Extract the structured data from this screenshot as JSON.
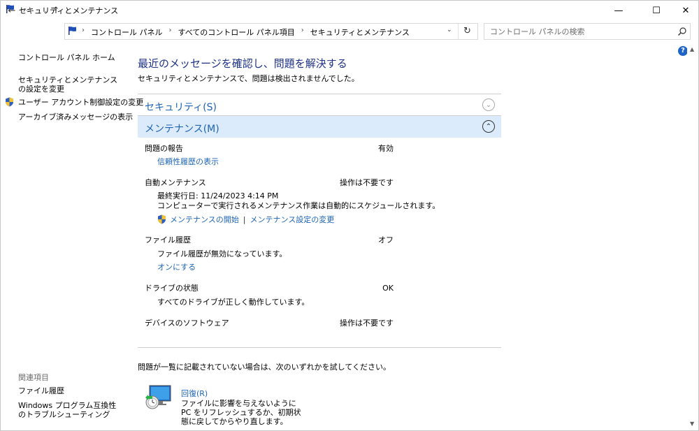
{
  "window": {
    "title": "セキュリティとメンテナンス",
    "minimize": "—",
    "maximize": "☐",
    "close": "✕"
  },
  "nav": {
    "back": "←",
    "forward": "→",
    "recent": "⌄",
    "up": "↑"
  },
  "address": {
    "crumbs": [
      "コントロール パネル",
      "すべてのコントロール パネル項目",
      "セキュリティとメンテナンス"
    ],
    "separator": "›",
    "first_separator": "›",
    "dropdown": "⌄",
    "refresh": "↻"
  },
  "search": {
    "placeholder": "コントロール パネルの検索"
  },
  "sidebar": {
    "home": "コントロール パネル ホーム",
    "settings": "セキュリティとメンテナンスの設定を変更",
    "uac": "ユーザー アカウント制御設定の変更",
    "archive": "アーカイブ済みメッセージの表示",
    "related_title": "関連項目",
    "file_history": "ファイル履歴",
    "compat": "Windows プログラム互換性のトラブルシューティング"
  },
  "main": {
    "heading": "最近のメッセージを確認し、問題を解決する",
    "subheading": "セキュリティとメンテナンスで、問題は検出されませんでした。",
    "security_label": "セキュリティ(S)",
    "maintenance_label": "メンテナンス(M)",
    "expand_glyph": "⌄",
    "collapse_glyph": "⌃",
    "problem_report": {
      "title": "問題の報告",
      "status": "有効",
      "link": "信頼性履歴の表示"
    },
    "auto_maint": {
      "title": "自動メンテナンス",
      "status": "操作は不要です",
      "last_run": "最終実行日: 11/24/2023 4:14 PM",
      "desc": "コンピューターで実行されるメンテナンス作業は自動的にスケジュールされます。",
      "start_link": "メンテナンスの開始",
      "divider": "|",
      "settings_link": "メンテナンス設定の変更"
    },
    "file_history": {
      "title": "ファイル履歴",
      "status": "オフ",
      "desc": "ファイル履歴が無効になっています。",
      "link": "オンにする"
    },
    "drive": {
      "title": "ドライブの状態",
      "status": "OK",
      "desc": "すべてのドライブが正しく動作しています。"
    },
    "device_sw": {
      "title": "デバイスのソフトウェア",
      "status": "操作は不要です"
    },
    "try_text": "問題が一覧に記載されていない場合は、次のいずれかを試してください。",
    "recovery": {
      "title": "回復(R)",
      "desc": "ファイルに影響を与えないように PC をリフレッシュするか、初期状態に戻してからやり直します。"
    }
  },
  "help": "?",
  "scroll": {
    "up": "▲",
    "down": "▼"
  },
  "colors": {
    "link": "#1e64b4",
    "heading": "#1e3287",
    "section_highlight": "#dcebfb"
  }
}
